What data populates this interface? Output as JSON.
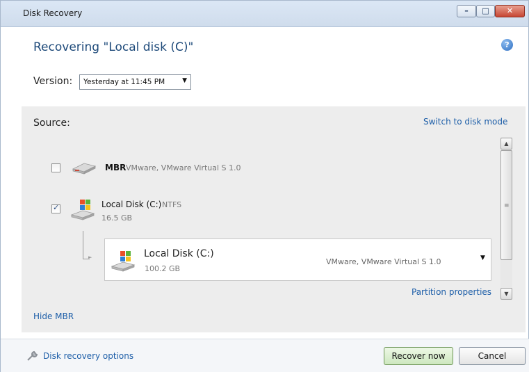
{
  "window": {
    "title": "Disk Recovery",
    "controls": {
      "minimize": "–",
      "maximize": "□",
      "close": "✕"
    }
  },
  "heading": "Recovering \"Local disk (C)\"",
  "help_icon": "question-icon",
  "version": {
    "label": "Version:",
    "selected": "Yesterday at 11:45 PM"
  },
  "source": {
    "label": "Source:",
    "switch_link": "Switch to disk mode",
    "items": [
      {
        "checked": false,
        "title": "MBR",
        "subtitle": "VMware, VMware Virtual S 1.0",
        "icon": "hard-drive-icon"
      },
      {
        "checked": true,
        "title": "Local Disk (C:)",
        "subtitle": "NTFS",
        "size": "16.5 GB",
        "icon": "windows-disk-icon"
      }
    ],
    "target_partition": {
      "title": "Local Disk (C:)",
      "size": "100.2 GB",
      "vendor": "VMware, VMware Virtual S 1.0"
    },
    "partition_properties_link": "Partition properties",
    "hide_mbr_link": "Hide MBR"
  },
  "footer": {
    "options_link": "Disk recovery options",
    "recover_button": "Recover now",
    "cancel_button": "Cancel"
  },
  "colors": {
    "link": "#1d5ea8",
    "heading": "#1e4a7a",
    "panel": "#ededed",
    "primary_button": "#cde7bf"
  }
}
